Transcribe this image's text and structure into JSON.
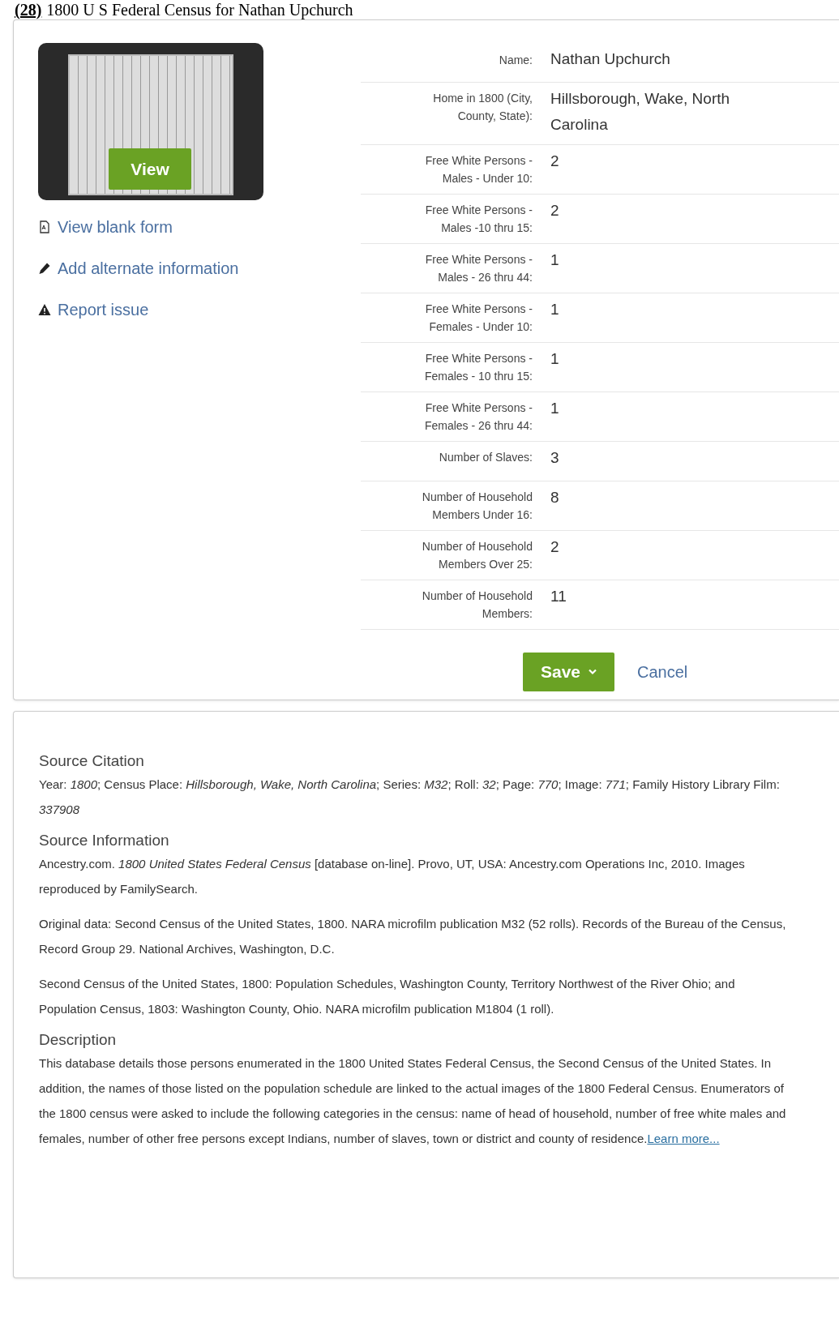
{
  "page_heading": {
    "number": "(28)",
    "title": "1800 U S Federal Census for Nathan Upchurch"
  },
  "record": {
    "image_button": "View",
    "links": [
      {
        "kind": "form",
        "label": "View blank form"
      },
      {
        "kind": "edit",
        "label": "Add alternate information"
      },
      {
        "kind": "warning",
        "label": "Report issue"
      }
    ],
    "fields": [
      {
        "label": "Name:",
        "value": "Nathan Upchurch"
      },
      {
        "label": "Home in 1800 (City, County, State):",
        "value": "Hillsborough, Wake, North Carolina"
      },
      {
        "label": "Free White Persons - Males - Under 10:",
        "value": "2"
      },
      {
        "label": "Free White Persons - Males -10 thru 15:",
        "value": "2"
      },
      {
        "label": "Free White Persons - Males - 26 thru 44:",
        "value": "1"
      },
      {
        "label": "Free White Persons - Females - Under 10:",
        "value": "1"
      },
      {
        "label": "Free White Persons - Females - 10 thru 15:",
        "value": "1"
      },
      {
        "label": "Free White Persons - Females - 26 thru 44:",
        "value": "1"
      },
      {
        "label": "Number of Slaves:",
        "value": "3"
      },
      {
        "label": "Number of Household Members Under 16:",
        "value": "8"
      },
      {
        "label": "Number of Household Members Over 25:",
        "value": "2"
      },
      {
        "label": "Number of Household Members:",
        "value": "11"
      }
    ],
    "save_button": "Save",
    "cancel_link": "Cancel"
  },
  "source": {
    "sections": [
      {
        "heading": "Source Citation",
        "paragraphs": [
          "Year: *1800*; Census Place: *Hillsborough, Wake, North Carolina*; Series: *M32*; Roll: *32*; Page: *770*; Image: *771*; Family History Library Film: *337908*"
        ]
      },
      {
        "heading": "Source Information",
        "paragraphs": [
          "Ancestry.com. *1800 United States Federal Census* [database on-line]. Provo, UT, USA: Ancestry.com Operations Inc, 2010. Images reproduced by FamilySearch.",
          "Original data: Second Census of the United States, 1800. NARA microfilm publication M32 (52 rolls). Records of the Bureau of the Census, Record Group 29. National Archives, Washington, D.C.",
          "Second Census of the United States, 1800: Population Schedules, Washington County, Territory Northwest of the River Ohio; and Population Census, 1803: Washington County, Ohio. NARA microfilm publication M1804 (1 roll)."
        ]
      },
      {
        "heading": "Description",
        "paragraphs": [
          "This database details those persons enumerated in the 1800 United States Federal Census, the Second Census of the United States. In addition, the names of those listed on the population schedule are linked to the actual images of the 1800 Federal Census. Enumerators of the 1800 census were asked to include the following categories in the census: name of head of household, number of free white males and females, number of other free persons except Indians, number of slaves, town or district and county of residence."
        ],
        "link": "Learn more..."
      }
    ]
  }
}
